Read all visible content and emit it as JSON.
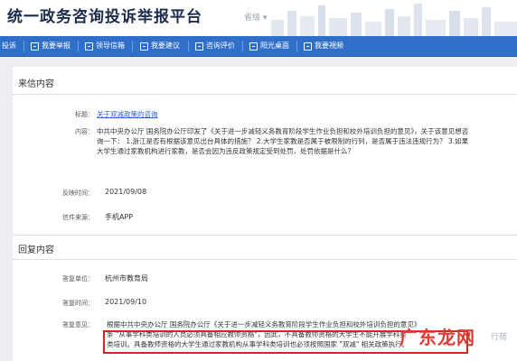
{
  "header": {
    "title": "统一政务咨询投诉举报平台",
    "location": "省级 ▾"
  },
  "nav": {
    "items": [
      {
        "label": "投诉"
      },
      {
        "label": "我要举报"
      },
      {
        "label": "领导信箱"
      },
      {
        "label": "我要建议"
      },
      {
        "label": "咨询评价"
      },
      {
        "label": "阳光桌面"
      },
      {
        "label": "我要視频"
      }
    ]
  },
  "letter": {
    "section_title": "来信内容",
    "subject_label": "标题：",
    "subject": "关于双减政策的咨询",
    "content_label": "内容：",
    "content": "中共中央办公厅 国务院办公厅印发了《关于进一步减轻义务教育阶段学生作业负担和校外培训负担的意见》，关于该意见想咨询一下： 1.浙江是否有根据该意见出台具体的措施？ 2.大学生家教是否属于被限制的行列，是否属于违法违规行为？ 3.如果大学生通过家教机构进行家教，是否会因为违反政策规定受到处罚，处罚依据是什么？",
    "time_label": "反映时间：",
    "time": "2021/09/08",
    "source_label": "信件来源：",
    "source": "手机APP"
  },
  "reply": {
    "section_title": "回复内容",
    "unit_label": "答复单位：",
    "unit": "杭州市教育局",
    "time_label": "答复时间：",
    "time": "2021/09/10",
    "opinion_label": "答复意见：",
    "opinion_line1": "根据中共中央办公厅 国务院办公厅《关于进一步减轻义务教育阶段学生作业负担和校外培训负担的意见》",
    "opinion_line2": "条 \"从事学科类培训的人员必须具备相应教师资格\"，因此，不具备教师资格的大学生不能开展学科类",
    "opinion_line3": "类培训。具备教师资格的大学生通过家教机构从事学科类培训也必须按照国家 \"双减\" 相关政策执行。"
  },
  "watermark": {
    "text": "广东龙网",
    "suffix": "行苑"
  }
}
